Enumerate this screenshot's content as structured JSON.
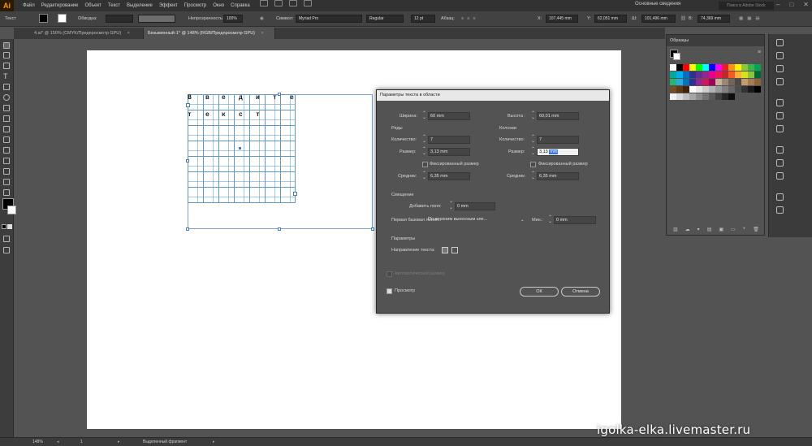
{
  "app": {
    "logo": "Ai"
  },
  "menu": [
    "Файл",
    "Редактирование",
    "Объект",
    "Текст",
    "Выделение",
    "Эффект",
    "Просмотр",
    "Окно",
    "Справка"
  ],
  "workspace": "Основные сведения",
  "search_placeholder": "Поиск в Adobe Stock",
  "controlbar": {
    "tool_name": "Текст",
    "stroke_label": "Обводка:",
    "opacity_label": "Непрозрачность:",
    "opacity_value": "100%",
    "char_label": "Символ:",
    "font": "Myriad Pro",
    "style": "Regular",
    "size": "12 pt",
    "para_label": "Абзац:",
    "x_label": "X:",
    "x_value": "107,445 mm",
    "y_label": "Y:",
    "y_value": "62,051 mm",
    "w_label": "Ш:",
    "w_value": "101,496 mm",
    "h_label": "В:",
    "h_value": "74,369 mm"
  },
  "tabs": [
    {
      "label": "4.ai* @ 150% (CMYK/Предпросмотр GPU)",
      "close": "×"
    },
    {
      "label": "Безымянный-1* @ 148% (RGB/Предпросмотр GPU)",
      "close": "×"
    }
  ],
  "canvas": {
    "row1": [
      "В",
      "в",
      "е",
      "д",
      "и",
      "т",
      "е"
    ],
    "row2": [
      "т",
      "е",
      "к",
      "с",
      "т"
    ]
  },
  "dialog": {
    "title": "Параметры текста в области",
    "width_label": "Ширина:",
    "width_value": "60 mm",
    "height_label": "Высота :",
    "height_value": "60,01 mm",
    "rows_heading": "Ряды",
    "cols_heading": "Колонки",
    "count_label": "Количество:",
    "rows_count": "7",
    "cols_count": "7",
    "size_label": "Размер:",
    "rows_size": "3,13 mm",
    "cols_size_num": "3,13",
    "cols_size_unit": "mm",
    "fixed_label": "Фиксированный размер",
    "gutter_label": "Средник:",
    "rows_gutter": "6,35 mm",
    "cols_gutter": "6,35 mm",
    "offset_heading": "Смещение",
    "inset_label": "Добавить поля:",
    "inset_value": "0 mm",
    "baseline_label": "Первая базовая линия:",
    "baseline_value": "По верхним выносным эле...",
    "min_label": "Мин.:",
    "min_value": "0 mm",
    "options_heading": "Параметры",
    "direction_label": "Направление текста:",
    "auto_size_label": "Автоматический размер",
    "preview_label": "Просмотр",
    "ok_label": "ОК",
    "cancel_label": "Отмена"
  },
  "swatches_panel": {
    "title": "Образцы",
    "colors_row1": [
      "#ffffff",
      "#000000",
      "#ff0000",
      "#ffff00",
      "#00ff00",
      "#00ffff",
      "#0000ff",
      "#ff00ff",
      "#ed1c24",
      "#f7941d",
      "#fff200",
      "#8dc63f",
      "#39b54a",
      "#00a651"
    ],
    "colors_row2": [
      "#00a99d",
      "#00aeef",
      "#0072bc",
      "#2e3192",
      "#662d91",
      "#92278f",
      "#ec008c",
      "#ed145b",
      "#c1272d",
      "#f15a24",
      "#fbb03b",
      "#d9e021",
      "#8cc63f",
      "#006837"
    ],
    "colors_row3": [
      "#22b573",
      "#29abe2",
      "#0071bc",
      "#2e3192",
      "#93278f",
      "#d4145a",
      "#9e005d",
      "#c7b299",
      "#998675",
      "#736357",
      "#534741",
      "#c69c6d",
      "#a67c52",
      "#8c6239"
    ],
    "colors_row4": [
      "#754c24",
      "#603813",
      "#42210b",
      "#ffffff",
      "#e6e6e6",
      "#cccccc",
      "#b3b3b3",
      "#999999",
      "#808080",
      "#666666",
      "#4d4d4d",
      "#333333",
      "#1a1a1a",
      "#000000"
    ],
    "colors_row5": [
      "#f2f2f2",
      "#d9d9d9",
      "#bfbfbf",
      "#a6a6a6",
      "#8c8c8c",
      "#737373",
      "#595959",
      "#404040",
      "#262626",
      "#0d0d0d"
    ]
  },
  "status": {
    "zoom": "148%",
    "page": "1",
    "selection": "Выделенный фрагмент"
  },
  "watermark": "igolka-elka.livemaster.ru"
}
